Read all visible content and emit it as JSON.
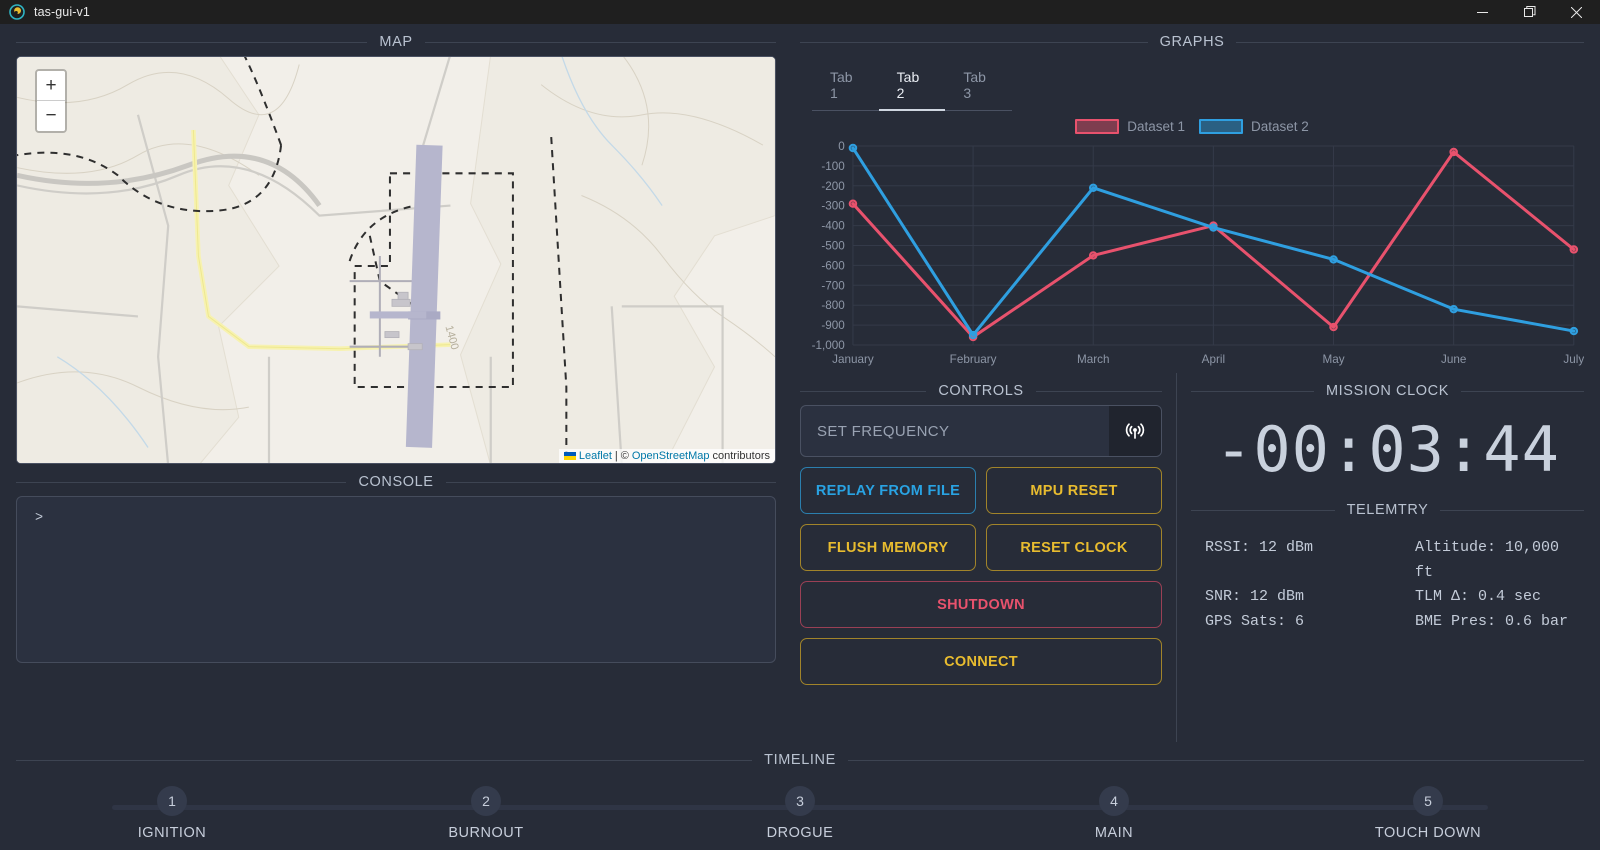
{
  "window": {
    "title": "tas-gui-v1",
    "app_icon": "app-logo-icon",
    "minimize": "–",
    "maximize": "❐",
    "close": "✕"
  },
  "map": {
    "heading": "MAP",
    "zoom_in": "+",
    "zoom_out": "−",
    "attribution": {
      "flag": "ukraine-flag-icon",
      "leaflet": "Leaflet",
      "separator": "|",
      "copyright": "©",
      "osm": "OpenStreetMap",
      "suffix": "contributors"
    },
    "contour_label": "1400"
  },
  "console": {
    "heading": "CONSOLE",
    "prompt": ">"
  },
  "graphs": {
    "heading": "GRAPHS",
    "tabs": [
      {
        "label": "Tab 1",
        "active": false
      },
      {
        "label": "Tab 2",
        "active": true
      },
      {
        "label": "Tab 3",
        "active": false
      }
    ]
  },
  "chart_data": {
    "type": "line",
    "title": "",
    "xlabel": "",
    "ylabel": "",
    "grid": true,
    "legend_position": "top",
    "categories": [
      "January",
      "February",
      "March",
      "April",
      "May",
      "June",
      "July"
    ],
    "yticks": [
      0,
      -100,
      -200,
      -300,
      -400,
      -500,
      -600,
      -700,
      -800,
      -900,
      -1000
    ],
    "yticklabels": [
      "0",
      "-100",
      "-200",
      "-300",
      "-400",
      "-500",
      "-600",
      "-700",
      "-800",
      "-900",
      "-1,000"
    ],
    "ylim": [
      -1000,
      0
    ],
    "series": [
      {
        "name": "Dataset 1",
        "color": "#e8526d",
        "fill": "rgba(232,82,109,0.45)",
        "values": [
          -290,
          -960,
          -550,
          -400,
          -910,
          -30,
          -520
        ]
      },
      {
        "name": "Dataset 2",
        "color": "#2f9fe0",
        "fill": "rgba(47,159,224,0.45)",
        "values": [
          -10,
          -950,
          -210,
          -410,
          -570,
          -820,
          -930
        ]
      }
    ]
  },
  "controls": {
    "heading": "CONTROLS",
    "frequency_placeholder": "SET FREQUENCY",
    "frequency_value": "",
    "frequency_button_icon": "broadcast-tower-icon",
    "buttons": [
      {
        "label": "REPLAY FROM FILE",
        "style": "blue"
      },
      {
        "label": "MPU RESET",
        "style": "yellow"
      },
      {
        "label": "FLUSH MEMORY",
        "style": "yellow"
      },
      {
        "label": "RESET CLOCK",
        "style": "yellow"
      },
      {
        "label": "SHUTDOWN",
        "style": "red"
      },
      {
        "label": "CONNECT",
        "style": "yellow"
      }
    ]
  },
  "mission_clock": {
    "heading": "MISSION CLOCK",
    "value": "-00:03:44"
  },
  "telemetry": {
    "heading": "TELEMTRY",
    "rows": [
      "RSSI: 12 dBm",
      "SNR: 12 dBm",
      "TLM Δ: 0.4 sec",
      "GPS Sats: 6",
      "BME Pres: 0.6 bar"
    ],
    "altitude": "Altitude: 10,000 ft"
  },
  "timeline": {
    "heading": "TIMELINE",
    "steps": [
      {
        "num": "1",
        "label": "IGNITION"
      },
      {
        "num": "2",
        "label": "BURNOUT"
      },
      {
        "num": "3",
        "label": "DROGUE"
      },
      {
        "num": "4",
        "label": "MAIN"
      },
      {
        "num": "5",
        "label": "TOUCH DOWN"
      }
    ]
  },
  "colors": {
    "background": "#272c38",
    "panel": "#2b3140",
    "border": "#4a5162",
    "accent_blue": "#29a3e3",
    "accent_yellow": "#e8bc2f",
    "accent_red": "#e8526d",
    "text": "#c7cedb"
  }
}
